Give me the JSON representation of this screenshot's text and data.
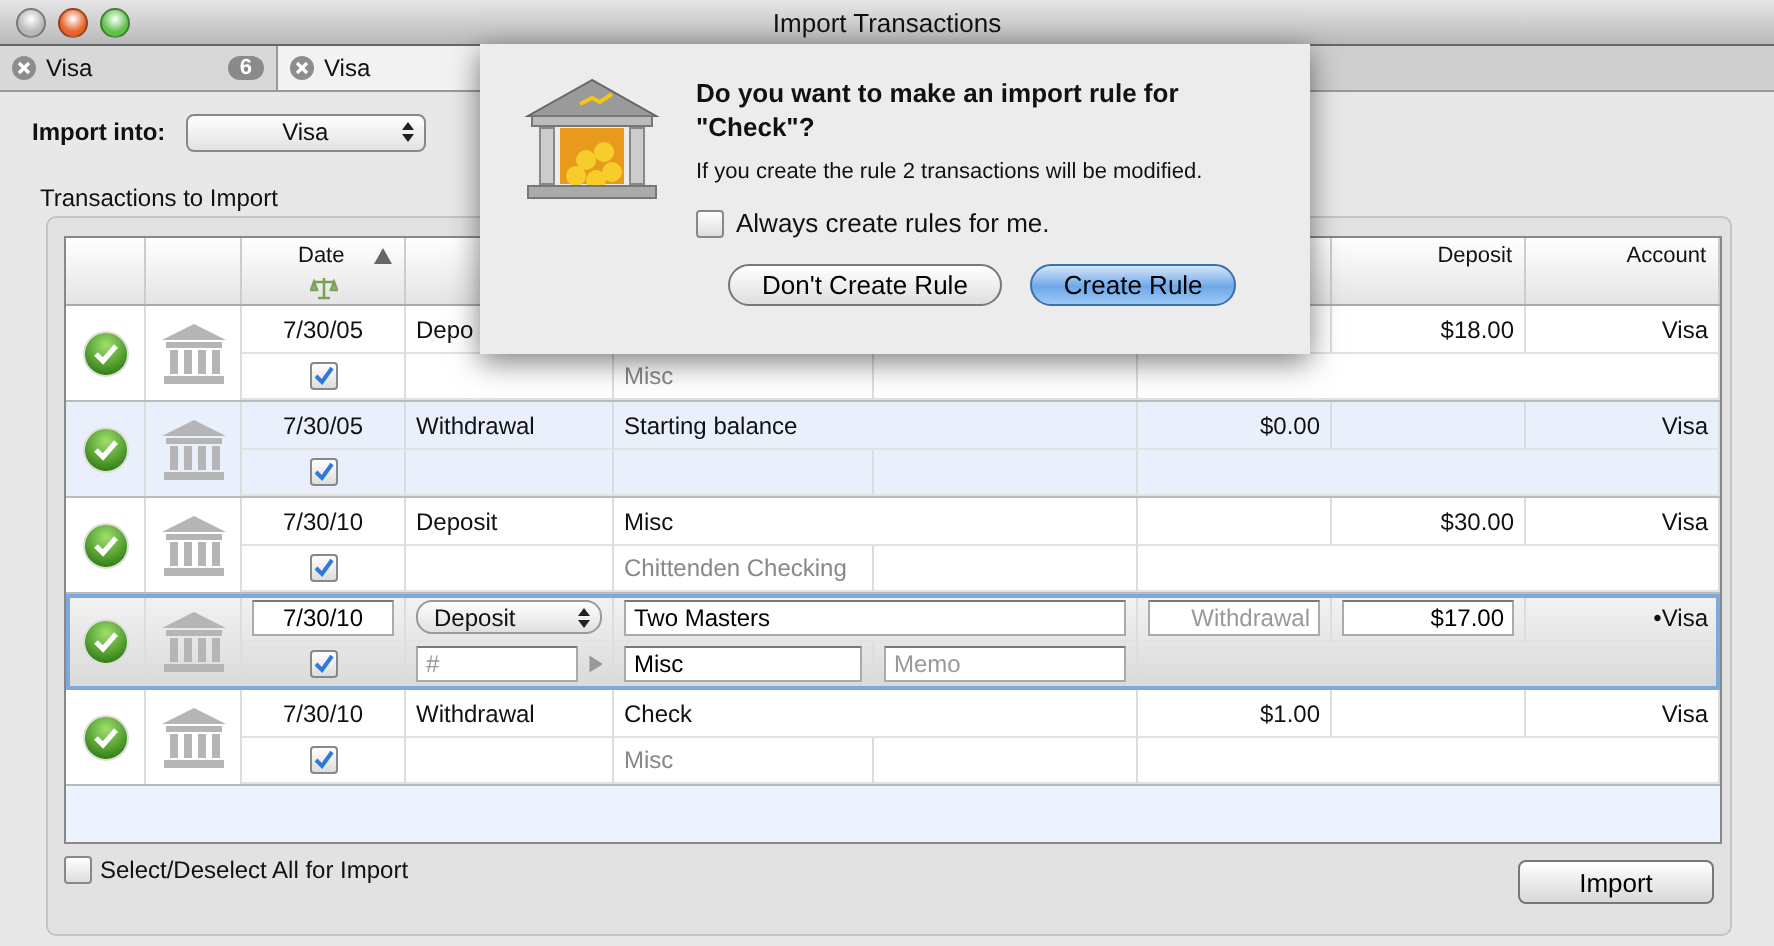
{
  "window": {
    "title": "Import Transactions"
  },
  "tabs": [
    {
      "label": "Visa",
      "badge": "6",
      "selected": false
    },
    {
      "label": "Visa",
      "selected": true
    }
  ],
  "import_into": {
    "label": "Import into:",
    "value": "Visa"
  },
  "group_title": "Transactions to Import",
  "table": {
    "columns": [
      {
        "label": "Date",
        "sorted": true
      },
      {
        "label": "Deposit"
      },
      {
        "label": "Account"
      }
    ],
    "rows": [
      {
        "date": "7/30/05",
        "included": true,
        "type": "Depo",
        "category": "Misc",
        "deposit": "$18.00",
        "account": "Visa",
        "editing": false
      },
      {
        "date": "7/30/05",
        "included": true,
        "type": "Withdrawal",
        "payee": "Starting balance",
        "withdrawal": "$0.00",
        "account": "Visa",
        "editing": false
      },
      {
        "date": "7/30/10",
        "included": true,
        "type": "Deposit",
        "payee": "Misc",
        "category": "Chittenden Checking",
        "deposit": "$30.00",
        "account": "Visa",
        "editing": false
      },
      {
        "date": "7/30/10",
        "included": true,
        "type": "Deposit",
        "number_placeholder": "#",
        "payee": "Two Masters",
        "category": "Misc",
        "memo_placeholder": "Memo",
        "withdrawal_placeholder": "Withdrawal",
        "deposit": "$17.00",
        "account": "•Visa",
        "editing": true
      },
      {
        "date": "7/30/10",
        "included": true,
        "type": "Withdrawal",
        "payee": "Check",
        "category": "Misc",
        "withdrawal": "$1.00",
        "account": "Visa",
        "editing": false
      }
    ]
  },
  "select_all": {
    "label": "Select/Deselect All for Import",
    "checked": false
  },
  "import_button": "Import",
  "dialog": {
    "title": "Do you want to make an import rule for \"Check\"?",
    "message": "If you create the rule 2 transactions will be modified.",
    "checkbox": {
      "label": "Always create rules for me.",
      "checked": false
    },
    "buttons": [
      {
        "label": "Don't Create Rule",
        "default": false
      },
      {
        "label": "Create Rule",
        "default": true
      }
    ]
  }
}
